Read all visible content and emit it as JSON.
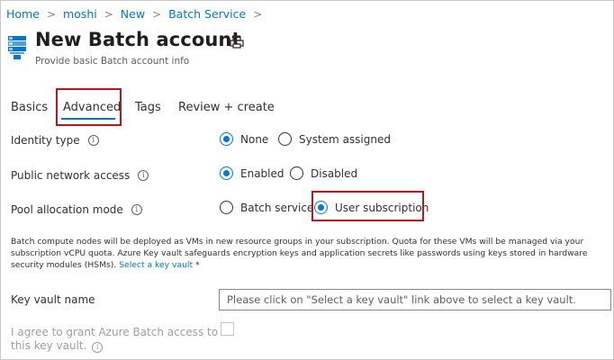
{
  "breadcrumb": {
    "items": [
      "Home",
      "moshi",
      "New",
      "Batch Service"
    ],
    "separator": ">"
  },
  "header": {
    "title": "New Batch account",
    "subtitle": "Provide basic Batch account info"
  },
  "tabs": [
    {
      "label": "Basics",
      "active": false
    },
    {
      "label": "Advanced",
      "active": true
    },
    {
      "label": "Tags",
      "active": false
    },
    {
      "label": "Review + create",
      "active": false
    }
  ],
  "form": {
    "identity_type": {
      "label": "Identity type",
      "options": [
        {
          "label": "None",
          "checked": true
        },
        {
          "label": "System assigned",
          "checked": false
        }
      ]
    },
    "public_network_access": {
      "label": "Public network access",
      "options": [
        {
          "label": "Enabled",
          "checked": true
        },
        {
          "label": "Disabled",
          "checked": false
        }
      ]
    },
    "pool_allocation_mode": {
      "label": "Pool allocation mode",
      "options": [
        {
          "label": "Batch service",
          "checked": false
        },
        {
          "label": "User subscription",
          "checked": true
        }
      ]
    },
    "description": {
      "text": "Batch compute nodes will be deployed as VMs in new resource groups in your subscription. Quota for these VMs will be managed via your subscription vCPU quota. Azure Key vault safeguards encryption keys and application secrets like passwords using keys stored in hardware security modules (HSMs).",
      "link": "Select a key vault",
      "required_marker": "*"
    },
    "key_vault_name": {
      "label": "Key vault name",
      "value": "Please click on \"Select a key vault\" link above to select a key vault."
    },
    "agree": {
      "label": "I agree to grant Azure Batch access to this key vault.",
      "checked": false,
      "disabled": true
    }
  },
  "colors": {
    "accent": "#0078d4",
    "highlight": "#c0141d",
    "text": "#323130",
    "disabled_text": "#a19f9d"
  },
  "icons": {
    "header": "batch-service-icon",
    "print": "print-icon",
    "info": "info-icon"
  }
}
